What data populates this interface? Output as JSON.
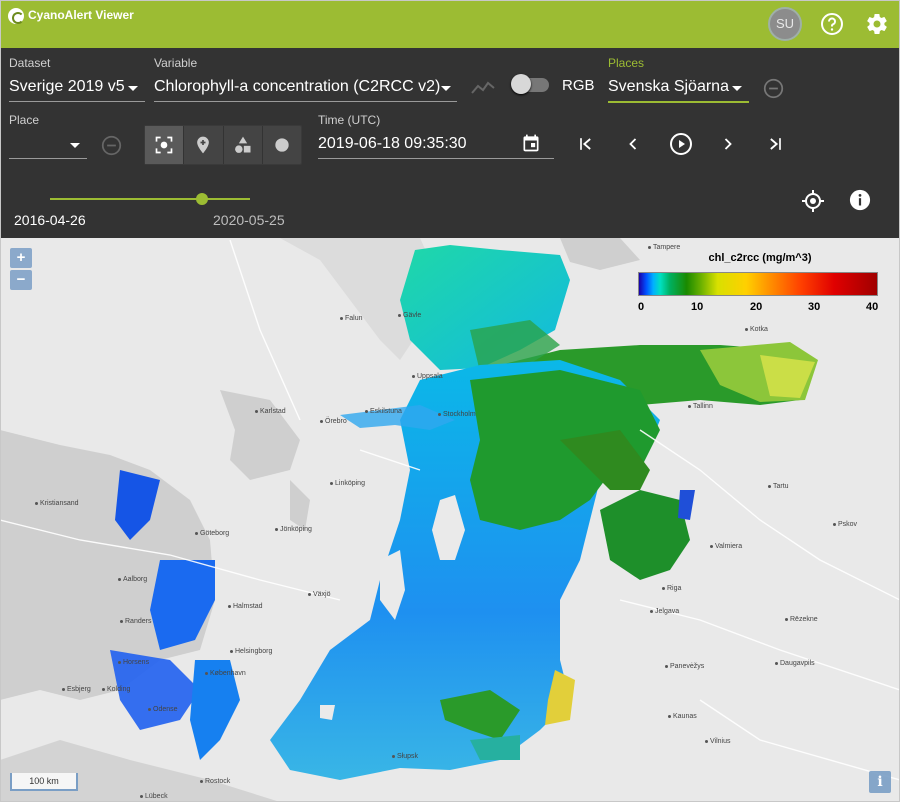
{
  "app": {
    "title": "CyanoAlert Viewer",
    "user_initials": "SU"
  },
  "controls": {
    "dataset": {
      "label": "Dataset",
      "value": "Sverige 2019 v5"
    },
    "variable": {
      "label": "Variable",
      "value": "Chlorophyll-a concentration (C2RCC v2)"
    },
    "rgb_label": "RGB",
    "places": {
      "label": "Places",
      "value": "Svenska Sjöarna"
    },
    "place": {
      "label": "Place",
      "value": ""
    },
    "time": {
      "label": "Time (UTC)",
      "value": "2019-06-18 09:35:30"
    },
    "time_range": {
      "start": "2016-04-26",
      "end": "2020-05-25",
      "slider_fraction": 0.76
    }
  },
  "legend": {
    "title": "chl_c2rcc (mg/m^3)",
    "ticks": [
      "0",
      "10",
      "20",
      "30",
      "40"
    ]
  },
  "map": {
    "scale_label": "100 km",
    "zoom_in": "+",
    "zoom_out": "−",
    "info_label": "i",
    "cities": [
      "Gävle",
      "Uppsala",
      "Eskilstuna",
      "Örebro",
      "Karlstad",
      "Linköping",
      "Jönköping",
      "Göteborg",
      "Kristiansand",
      "Aalborg",
      "Randers",
      "Halmstad",
      "Växjö",
      "Helsingborg",
      "København",
      "Horsens",
      "Kolding",
      "Esbjerg",
      "Odense",
      "Tallinn",
      "Tartu",
      "Valmiera",
      "Riga",
      "Jelgava",
      "Rēzekne",
      "Daugavpils",
      "Panevėžys",
      "Kaunas",
      "Vilnius",
      "Słupsk",
      "Rostock",
      "Lübeck",
      "Tampere",
      "Kotka",
      "Pskov",
      "Falun",
      "Stockholm"
    ]
  },
  "colors": {
    "appbar": "#9cbc33",
    "panel": "#333333",
    "accent": "#9cbc33"
  }
}
